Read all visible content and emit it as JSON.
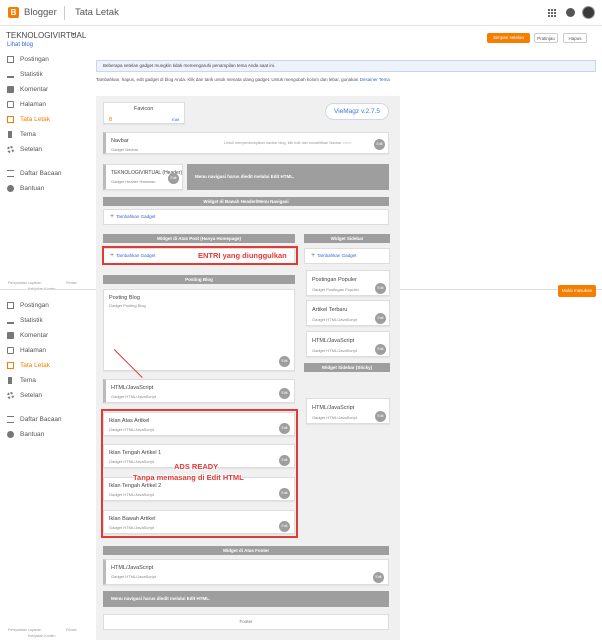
{
  "header": {
    "brand": "Blogger",
    "page": "Tata Letak",
    "logo_letter": "B"
  },
  "blog": {
    "title": "TEKNOLOGIVIRTUAL",
    "caret": "▾",
    "view_link": "Lihat blog"
  },
  "toolbar": {
    "save": "Simpan setelan",
    "preview": "Pratinjau",
    "delete": "Hapus"
  },
  "sidebar": {
    "items": [
      {
        "label": "Postingan"
      },
      {
        "label": "Statistik"
      },
      {
        "label": "Komentar"
      },
      {
        "label": "Halaman"
      },
      {
        "label": "Tata Letak"
      },
      {
        "label": "Tema"
      },
      {
        "label": "Setelan"
      }
    ],
    "secondary": [
      {
        "label": "Daftar Bacaan"
      },
      {
        "label": "Bantuan"
      }
    ],
    "footer": {
      "terms": "Persyaratan Layanan",
      "privacy": "Privasi",
      "content_policy": "Kebijakan Konten"
    }
  },
  "login_button": "Mulai masukan",
  "notice": "Beberapa setelan gadget mungkin tidak memengaruhi penampilan tema Anda saat ini.",
  "instructions": {
    "text": "Tambahkan, hapus, edit gadget di blog Anda. Klik dan tarik untuk menata ulang gadget. Untuk mengubah kolom dan lebar, gunakan",
    "link": "Desainer Tema"
  },
  "layout": {
    "favicon": {
      "title": "Favicon",
      "edit": "Edit"
    },
    "theme_badge": "VieMagz v.2.7.5",
    "navbar": {
      "title": "Navbar",
      "subtitle": "Gadget Navbar",
      "note": "Untuk menyembunyikan navbar blog, klik edit dan nonaktifkan Navbar >>>>"
    },
    "header": {
      "title": "TEKNOLOGIVIRTUAL (Header)",
      "subtitle": "Gadget Header Halaman"
    },
    "nav_note": "Menu navigasi harus diedit melalui Edit HTML.",
    "under_header_bar": "Widget di Bawah Header/Menu Navigasi",
    "add_gadget": "Tambahkan Gadget",
    "above_post_bar": "Widget di Atas Post (Hanya Homepage)",
    "sidebar_bar": "Widget Sidebar",
    "posting_bar": "Posting Blog",
    "posting_widget": {
      "title": "Posting Blog",
      "subtitle": "Gadget Posting Blog"
    },
    "popular": {
      "title": "Postingan Populer",
      "subtitle": "Gadget Postingan Populer"
    },
    "recent": {
      "title": "Artikel Terbaru",
      "subtitle": "Gadget HTML/JavaScript"
    },
    "html_js_1": {
      "title": "HTML/JavaScript",
      "subtitle": "Gadget HTML/JavaScript"
    },
    "sticky_bar": "Widget Sidebar (Sticky)",
    "html_js_sticky": {
      "title": "HTML/JavaScript",
      "subtitle": "Gadget HTML/JavaScript"
    },
    "html_js_main": {
      "title": "HTML/JavaScript",
      "subtitle": "Gadget HTML/JavaScript"
    },
    "ads": [
      {
        "title": "Iklan Atas Artikel",
        "subtitle": "Gadget HTML/JavaScript"
      },
      {
        "title": "Iklan Tengah Artikel 1",
        "subtitle": "Gadget HTML/JavaScript"
      },
      {
        "title": "Iklan Tengah Artikel 2",
        "subtitle": "Gadget HTML/JavaScript"
      },
      {
        "title": "Iklan Bawah Artikel",
        "subtitle": "Gadget HTML/JavaScript"
      }
    ],
    "footer_bar": "Widget di Atas Footer",
    "html_js_footer": {
      "title": "HTML/JavaScript",
      "subtitle": "Gadget HTML/JavaScript"
    },
    "footer_nav_note": "Menu navigasi harus diedit melalui Edit HTML.",
    "footer": "Footer",
    "edit": "Edit"
  },
  "annotations": {
    "featured": "ENTRI yang diunggulkan",
    "ads_line1": "ADS READY",
    "ads_line2": "Tanpa memasang di Edit HTML"
  },
  "colors": {
    "accent": "#f57d00",
    "annotation": "#e53935",
    "link": "#3367d6"
  }
}
